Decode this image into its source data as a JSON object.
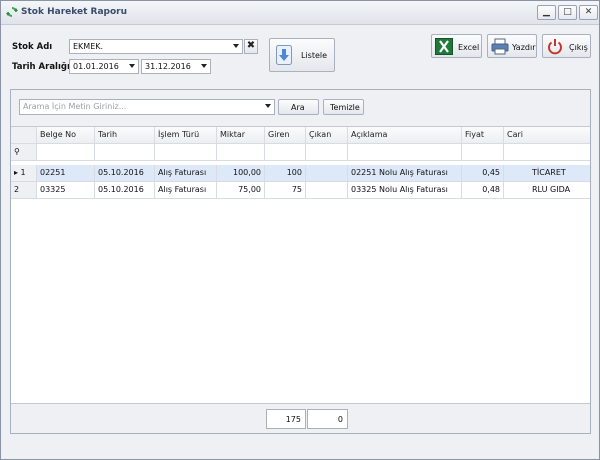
{
  "window": {
    "title": "Stok Hareket Raporu",
    "controls": {
      "minimize": "▁",
      "maximize": "□",
      "close": "✕"
    }
  },
  "form": {
    "stock_label": "Stok Adı",
    "stock_value": "EKMEK.",
    "date_label": "Tarih Aralığı",
    "date_from": "01.01.2016",
    "date_to": "31.12.2016",
    "clear_symbol": "✖"
  },
  "toolbar": {
    "list_label": "Listele",
    "excel_label": "Excel",
    "print_label": "Yazdır",
    "exit_label": "Çıkış"
  },
  "search": {
    "placeholder": "Arama İçin Metin Giriniz...",
    "search_label": "Ara",
    "clear_label": "Temizle"
  },
  "table": {
    "columns": [
      "Belge No",
      "Tarih",
      "İşlem Türü",
      "Miktar",
      "Giren",
      "Çıkan",
      "Açıklama",
      "Fiyat",
      "Cari"
    ],
    "filter_icon": "⚲",
    "rows": [
      {
        "indicator": "▸ 1",
        "belge": "02251",
        "tarih": "05.10.2016",
        "islem": "Alış Faturası",
        "miktar": "100,00",
        "giren": "100",
        "cikan": "",
        "aciklama": "02251 Nolu Alış Faturası",
        "fiyat": "0,45",
        "cari": "TİCARET"
      },
      {
        "indicator": "2",
        "belge": "03325",
        "tarih": "05.10.2016",
        "islem": "Alış Faturası",
        "miktar": "75,00",
        "giren": "75",
        "cikan": "",
        "aciklama": "03325 Nolu Alış Faturası",
        "fiyat": "0,48",
        "cari": "RLU GIDA"
      }
    ],
    "totals": {
      "giren": "175",
      "cikan": "0"
    }
  },
  "colors": {
    "selected_row": "#dde8f8",
    "excel_green": "#1f7a3a",
    "exit_red": "#c0392b",
    "title_text": "#3b4c6b"
  }
}
